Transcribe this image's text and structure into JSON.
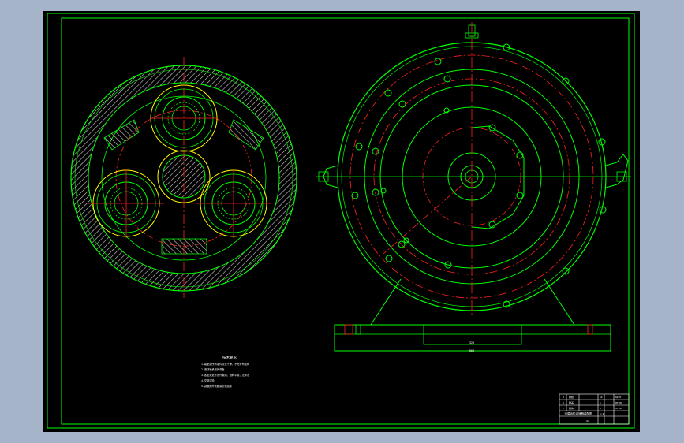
{
  "drawing": {
    "background_color": "#000000",
    "frame_color": "#00ff00",
    "centerline_color": "#ff2222",
    "hatch_color": "#cccccc",
    "notes_title": "技术要求",
    "notes": [
      "1.装配前所有零件清洗干净，不允许有毛刺",
      "2.滚动轴承用润滑脂",
      "3.各密封处不允许漏油，运转平稳，无冲击",
      "4.空载试验",
      "5.减速器外表面涂灰色油漆"
    ],
    "dimension_base_length": "560",
    "dimension_base_inner": "320"
  },
  "title_block": {
    "drawing_name": "行星齿轮减速器装配图",
    "scale": "1:2",
    "sheet": "A1",
    "rows": [
      [
        "4",
        "螺栓",
        "12",
        "Q235",
        ""
      ],
      [
        "3",
        "端盖",
        "1",
        "HT200",
        ""
      ],
      [
        "2",
        "箱体",
        "1",
        "HT200",
        ""
      ],
      [
        "1",
        "底座",
        "1",
        "HT200",
        ""
      ]
    ]
  }
}
